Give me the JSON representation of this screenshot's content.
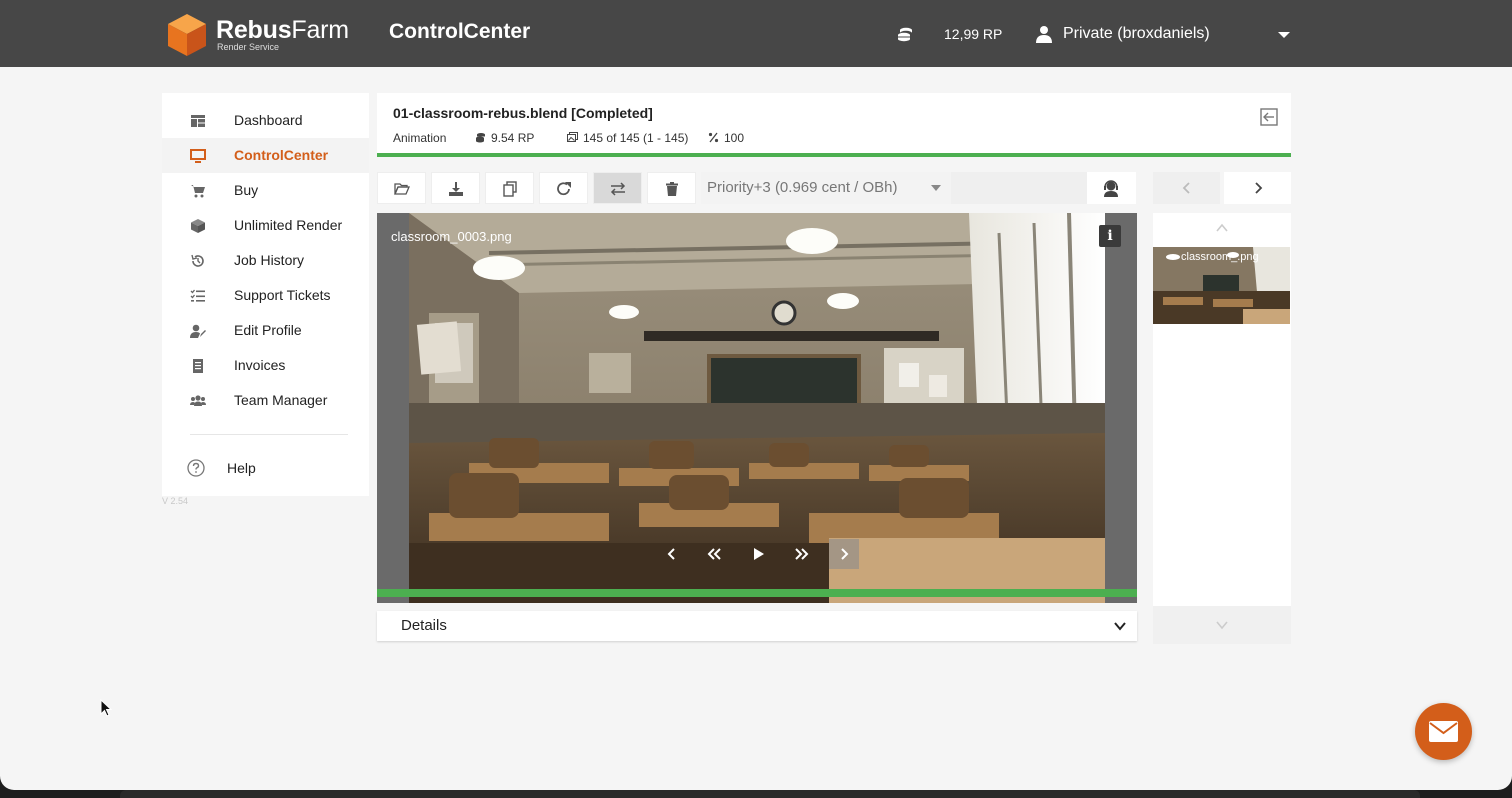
{
  "header": {
    "brand_bold": "Rebus",
    "brand_light": "Farm",
    "brand_sub": "Render Service",
    "app_title": "ControlCenter",
    "credits": "12,99 RP",
    "user": "Private (broxdaniels)"
  },
  "sidebar": {
    "items": [
      {
        "label": "Dashboard",
        "icon": "dashboard-icon"
      },
      {
        "label": "ControlCenter",
        "icon": "monitor-icon",
        "active": true
      },
      {
        "label": "Buy",
        "icon": "cart-icon"
      },
      {
        "label": "Unlimited Render",
        "icon": "box-icon"
      },
      {
        "label": "Job History",
        "icon": "history-icon"
      },
      {
        "label": "Support Tickets",
        "icon": "tasks-icon"
      },
      {
        "label": "Edit Profile",
        "icon": "user-edit-icon"
      },
      {
        "label": "Invoices",
        "icon": "invoice-icon"
      },
      {
        "label": "Team Manager",
        "icon": "team-icon"
      }
    ],
    "help": "Help",
    "version": "V 2.54"
  },
  "job": {
    "title": "01-classroom-rebus.blend [Completed]",
    "type": "Animation",
    "cost": "9.54 RP",
    "frames": "145 of 145 (1 - 145)",
    "percent": "100",
    "progress": 1.0
  },
  "toolbar": {
    "priority": "Priority+3 (0.969 cent / OBh)"
  },
  "preview": {
    "filename": "classroom_0003.png",
    "info": "i",
    "progress": 1.0
  },
  "details": {
    "label": "Details"
  },
  "thumbnails": [
    {
      "label": "classroom_.png"
    }
  ],
  "colors": {
    "accent": "#d35e1a",
    "header_bg": "#474747",
    "progress": "#4caf50"
  }
}
